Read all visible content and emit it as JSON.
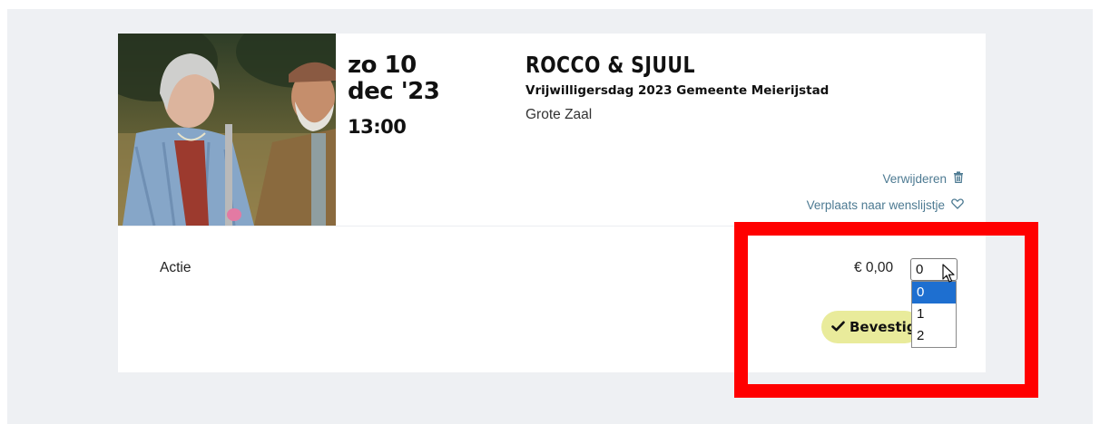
{
  "event": {
    "date_line1": "zo 10",
    "date_line2": "dec '23",
    "time": "13:00",
    "title": "ROCCO & SJUUL",
    "subtitle": "Vrijwilligersdag 2023 Gemeente Meierijstad",
    "venue": "Grote Zaal"
  },
  "actions": {
    "remove_label": "Verwijderen",
    "remove_icon": "trash-icon",
    "wishlist_label": "Verplaats naar wenslijstje",
    "wishlist_icon": "heart-icon"
  },
  "ticket": {
    "label": "Actie",
    "price": "€ 0,00",
    "quantity_selected": "0",
    "quantity_options": [
      "0",
      "1",
      "2"
    ],
    "confirm_label": "Bevestig",
    "confirm_icon": "checkmark-icon"
  },
  "colors": {
    "page_background": "#eef0f3",
    "link": "#4d7a92",
    "confirm_button": "#e9eb9b",
    "dropdown_selected": "#1e6fd0",
    "highlight": "#ff0000"
  }
}
